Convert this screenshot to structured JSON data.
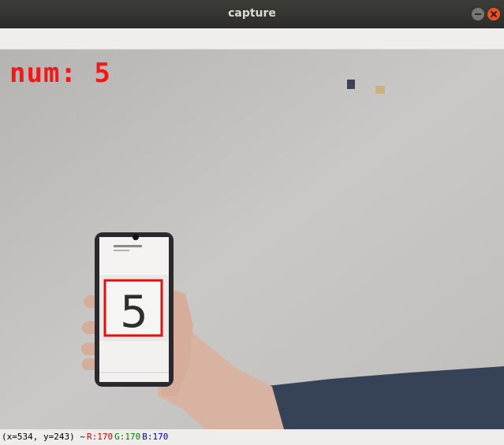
{
  "window": {
    "title": "capture"
  },
  "frame": {
    "overlay": "num: 5",
    "detected_digit": "5",
    "box_color": "#e01010"
  },
  "status": {
    "coords": "(x=534, y=243) ~",
    "r": "R:170",
    "g": "G:170",
    "b": "B:170"
  }
}
